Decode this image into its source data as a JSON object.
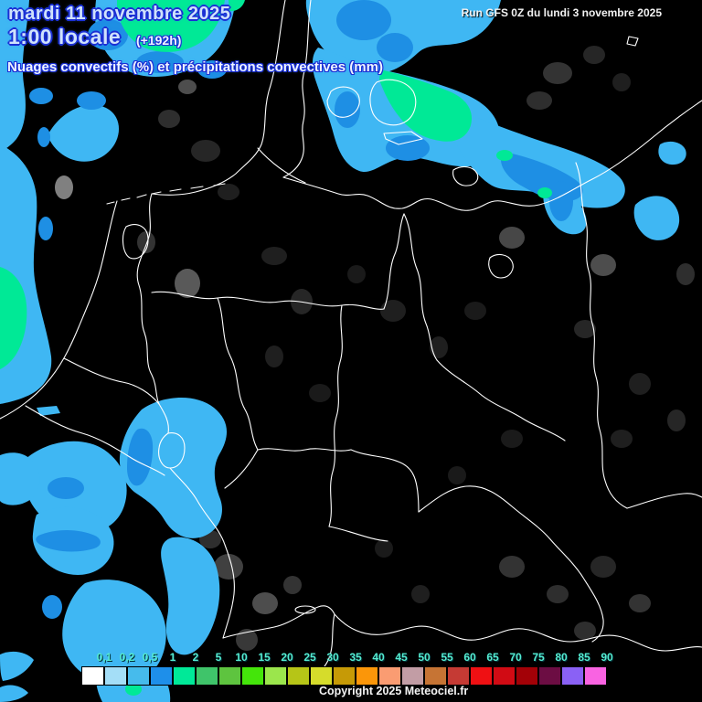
{
  "header": {
    "date": "mardi 11 novembre 2025",
    "time": "1:00 locale",
    "offset": "(+192h)",
    "subtitle": "Nuages convectifs (%) et précipitations convectives (mm)"
  },
  "run_info": "Run GFS 0Z du lundi 3 novembre 2025",
  "footer": {
    "copyright": "Copyright 2025 Meteociel.fr"
  },
  "legend": {
    "labels": [
      "0,1",
      "0,2",
      "0,5",
      "1",
      "2",
      "5",
      "10",
      "15",
      "20",
      "25",
      "30",
      "35",
      "40",
      "45",
      "50",
      "55",
      "60",
      "65",
      "70",
      "75",
      "80",
      "85",
      "90"
    ],
    "colors": [
      "#ffffff",
      "#a4def7",
      "#46bbec",
      "#1e8fea",
      "#00e998",
      "#3fc46a",
      "#5ec43f",
      "#44e50a",
      "#9be64c",
      "#b6c517",
      "#d6dc2b",
      "#c69a06",
      "#fb9609",
      "#fa9c72",
      "#c29da5",
      "#c67434",
      "#c53a34",
      "#ef1013",
      "#d10b14",
      "#a30107",
      "#6c0d43",
      "#8a61f5",
      "#f963e2"
    ],
    "label_color": "#55ebd0"
  },
  "map": {
    "background_color": "#000000",
    "border_color": "#ffffff",
    "precip_light_color": "#3fb7f3",
    "precip_medium_color": "#1e8fe4",
    "precip_heavy_color": "#00e996",
    "cloud_gray_color": "#bdbdbd"
  }
}
